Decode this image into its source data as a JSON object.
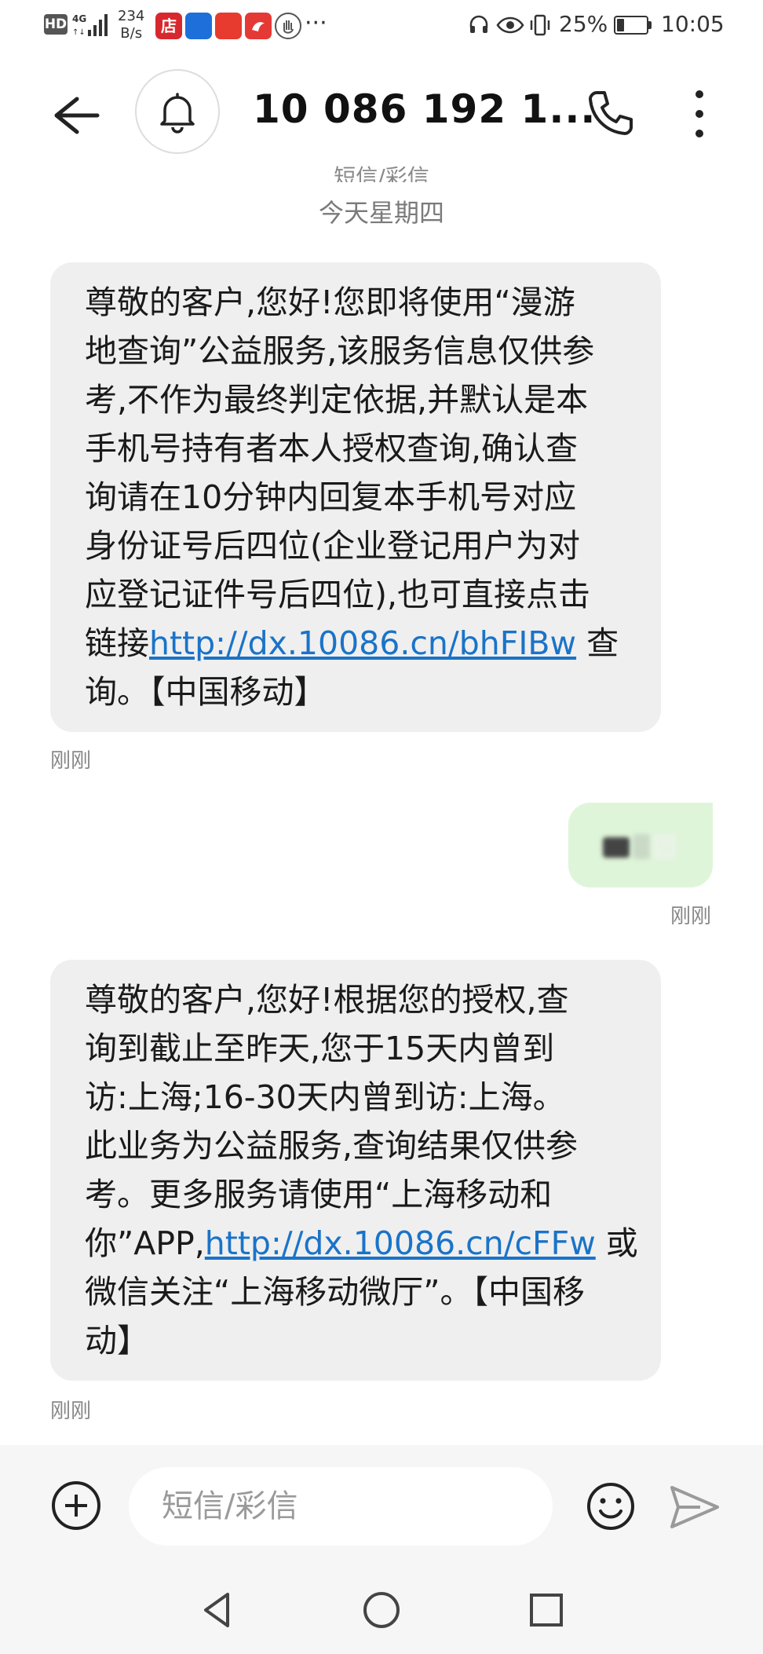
{
  "status_bar": {
    "hd": "HD",
    "network": "4G",
    "speed_value": "234",
    "speed_unit": "B/s",
    "app_icons": [
      "店",
      "",
      "",
      "",
      ""
    ],
    "more": "···",
    "battery": "25%",
    "battery_level": 0.25,
    "time": "10:05"
  },
  "header": {
    "contact": "10 086 192 1...",
    "avatar_icon": "bell-icon",
    "call_icon": "phone-icon",
    "menu_icon": "more-vertical-icon"
  },
  "thread": {
    "type_label": "短信/彩信",
    "date_label": "今天星期四"
  },
  "messages": [
    {
      "direction": "incoming",
      "lines": [
        "尊敬的客户,您好!您即将使用“漫游",
        "地查询”公益服务,该服务信息仅供参",
        "考,不作为最终判定依据,并默认是本",
        "手机号持有者本人授权查询,确认查",
        "询请在10分钟内回复本手机号对应",
        "身份证号后四位(企业登记用户为对",
        "应登记证件号后四位),也可直接点击"
      ],
      "link_prefix": "链接",
      "link": "http://dx.10086.cn/bhFIBw",
      "link_suffix": " 查",
      "last_line": "询。【中国移动】",
      "time": "刚刚"
    },
    {
      "direction": "outgoing",
      "content": "(redacted)",
      "time": "刚刚"
    },
    {
      "direction": "incoming",
      "lines": [
        "尊敬的客户,您好!根据您的授权,查",
        "询到截止至昨天,您于15天内曾到",
        "访:上海;16-30天内曾到访:上海。",
        "此业务为公益服务,查询结果仅供参",
        "考。更多服务请使用“上海移动和"
      ],
      "link_prefix": "你”APP,",
      "link": "http://dx.10086.cn/cFFw",
      "link_suffix": " 或",
      "extra_lines": [
        "微信关注“上海移动微厅”。【中国移",
        "动】"
      ],
      "time": "刚刚"
    }
  ],
  "composer": {
    "placeholder": "短信/彩信",
    "add_icon": "plus-circle-icon",
    "emoji_icon": "smiley-icon",
    "send_icon": "send-icon"
  },
  "nav": {
    "back_icon": "triangle-back-icon",
    "home_icon": "circle-home-icon",
    "recent_icon": "square-recents-icon"
  }
}
